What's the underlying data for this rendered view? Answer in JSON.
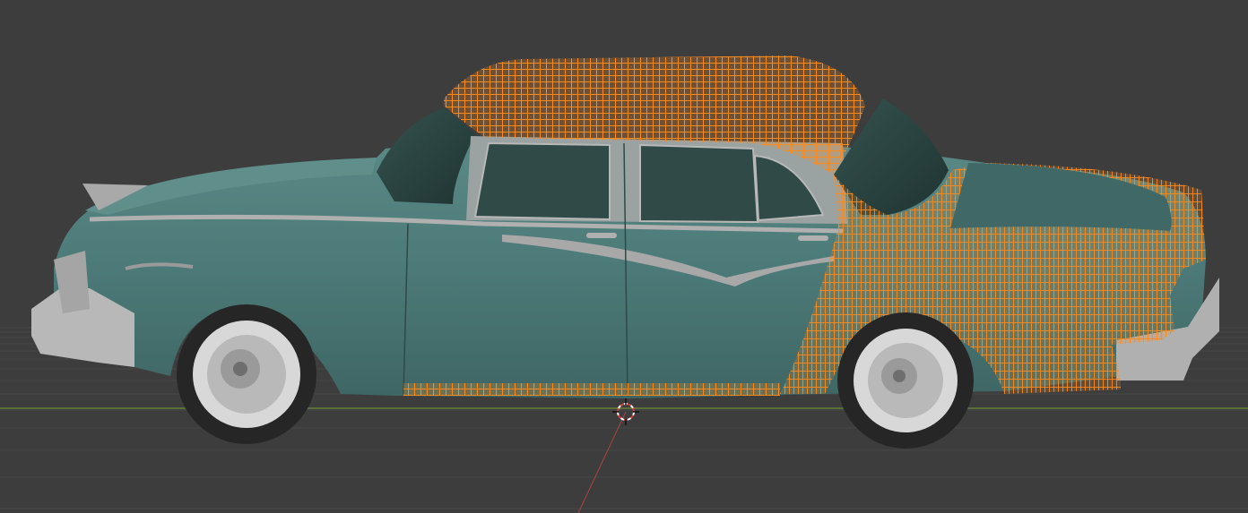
{
  "viewport": {
    "background": "#3d3d3d",
    "grid_color": "#4a4a4a",
    "x_axis_color": "#7b9a3a",
    "y_axis_color": "#b04a4a",
    "cursor_colors": [
      "#d43a3a",
      "#ffffff"
    ]
  },
  "scene": {
    "object_name": "car",
    "body_color": "#4c7a78",
    "body_highlight": "#5f8e8b",
    "body_shadow": "#3c6462",
    "glass_color": "#2a4744",
    "chrome_color": "#a9a9a9",
    "tire_color": "#2b2b2b",
    "whitewall_color": "#d8d8d8",
    "bumper_color": "#b5b5b5",
    "selection_wire_color": "#ff8a1c",
    "selection_faces": [
      "roof",
      "rear-quarter",
      "trunk",
      "rocker-panel"
    ]
  }
}
